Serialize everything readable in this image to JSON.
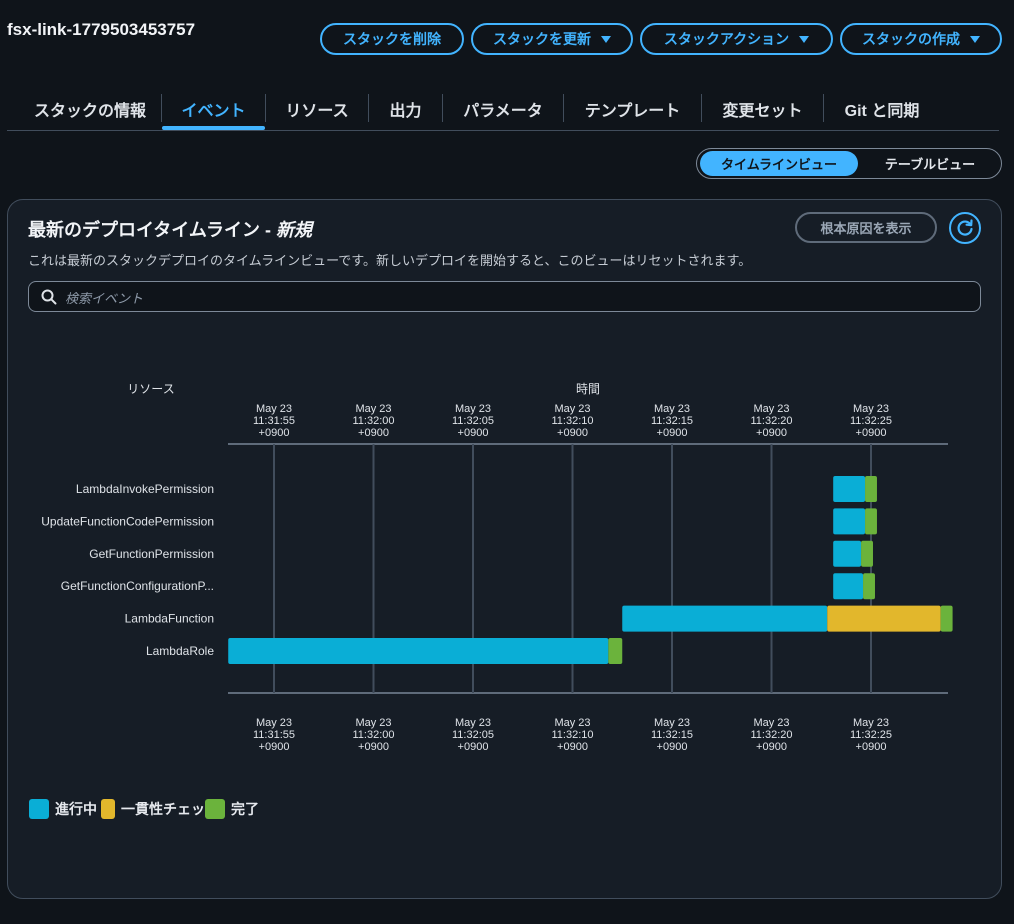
{
  "stack": {
    "name": "fsx-link-1779503453757"
  },
  "actions": {
    "delete": "スタックを削除",
    "update": "スタックを更新",
    "stack_actions": "スタックアクション",
    "create": "スタックの作成"
  },
  "tabs": [
    {
      "label": "スタックの情報"
    },
    {
      "label": "イベント"
    },
    {
      "label": "リソース"
    },
    {
      "label": "出力"
    },
    {
      "label": "パラメータ"
    },
    {
      "label": "テンプレート"
    },
    {
      "label": "変更セット"
    },
    {
      "label": "Git と同期"
    }
  ],
  "view_toggle": {
    "timeline": "タイムラインビュー",
    "table": "テーブルビュー"
  },
  "panel": {
    "title": "最新のデプロイタイムライン - ",
    "title_suffix": "新規",
    "description": "これは最新のスタックデプロイのタイムラインビューです。新しいデプロイを開始すると、このビューはリセットされます。",
    "root_cause_button": "根本原因を表示",
    "search_placeholder": "検索イベント"
  },
  "colors": {
    "in_progress": "#0aaed6",
    "consistency_check": "#e2b72c",
    "complete": "#6bb33c",
    "accent": "#42b4ff"
  },
  "chart_data": {
    "type": "timeline",
    "ylabel": "リソース",
    "xlabel": "時間",
    "ticks": [
      {
        "t": 0,
        "label": [
          "May 23",
          "11:31:55",
          "+0900"
        ]
      },
      {
        "t": 5,
        "label": [
          "May 23",
          "11:32:00",
          "+0900"
        ]
      },
      {
        "t": 10,
        "label": [
          "May 23",
          "11:32:05",
          "+0900"
        ]
      },
      {
        "t": 15,
        "label": [
          "May 23",
          "11:32:10",
          "+0900"
        ]
      },
      {
        "t": 20,
        "label": [
          "May 23",
          "11:32:15",
          "+0900"
        ]
      },
      {
        "t": 25,
        "label": [
          "May 23",
          "11:32:20",
          "+0900"
        ]
      },
      {
        "t": 30,
        "label": [
          "May 23",
          "11:32:25",
          "+0900"
        ]
      }
    ],
    "xlim": [
      -2.3,
      33.8
    ],
    "resources": [
      {
        "name": "LambdaInvokePermission",
        "segments": [
          {
            "status": "in_progress",
            "start": 28.1,
            "end": 29.7
          },
          {
            "status": "complete",
            "start": 29.7,
            "end": 30.3
          }
        ]
      },
      {
        "name": "UpdateFunctionCodePermission",
        "segments": [
          {
            "status": "in_progress",
            "start": 28.1,
            "end": 29.7
          },
          {
            "status": "complete",
            "start": 29.7,
            "end": 30.3
          }
        ]
      },
      {
        "name": "GetFunctionPermission",
        "segments": [
          {
            "status": "in_progress",
            "start": 28.1,
            "end": 29.5
          },
          {
            "status": "complete",
            "start": 29.5,
            "end": 30.1
          }
        ]
      },
      {
        "name": "GetFunctionConfigurationP...",
        "segments": [
          {
            "status": "in_progress",
            "start": 28.1,
            "end": 29.6
          },
          {
            "status": "complete",
            "start": 29.6,
            "end": 30.2
          }
        ]
      },
      {
        "name": "LambdaFunction",
        "segments": [
          {
            "status": "in_progress",
            "start": 17.5,
            "end": 27.8
          },
          {
            "status": "consistency_check",
            "start": 27.8,
            "end": 33.5
          },
          {
            "status": "complete",
            "start": 33.5,
            "end": 34.1
          }
        ]
      },
      {
        "name": "LambdaRole",
        "segments": [
          {
            "status": "in_progress",
            "start": -2.3,
            "end": 16.8
          },
          {
            "status": "complete",
            "start": 16.8,
            "end": 17.5
          }
        ]
      }
    ],
    "legend": [
      {
        "status": "in_progress",
        "label": "進行中"
      },
      {
        "status": "consistency_check",
        "label": "一貫性チェッ"
      },
      {
        "status": "complete",
        "label": "完了"
      }
    ]
  }
}
